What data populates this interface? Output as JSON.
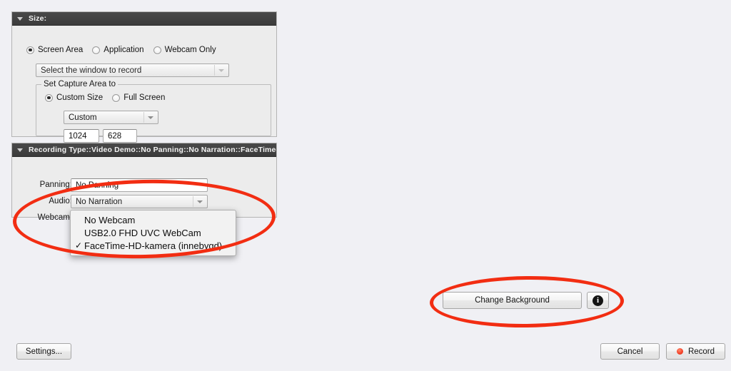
{
  "size_panel": {
    "title": "Size:",
    "disclosure_icon": "triangle-down-icon",
    "mode_options": [
      {
        "label": "Screen Area",
        "selected": true
      },
      {
        "label": "Application",
        "selected": false
      },
      {
        "label": "Webcam Only",
        "selected": false
      }
    ],
    "window_select": {
      "value": "Select the window to record",
      "enabled": false,
      "arrow_icon": "triangle-down-icon"
    },
    "capture_area": {
      "group_title": "Set Capture Area to",
      "options": [
        {
          "label": "Custom Size",
          "selected": true
        },
        {
          "label": "Full Screen",
          "selected": false
        }
      ],
      "preset_select": {
        "value": "Custom",
        "arrow_icon": "triangle-down-icon"
      },
      "width_field": {
        "value": "1024"
      },
      "height_field": {
        "value": "628"
      }
    }
  },
  "recording_panel": {
    "title": "Recording Type::Video Demo::No Panning::No Narration::FaceTime–...",
    "disclosure_icon": "triangle-down-icon",
    "fields": [
      {
        "label": "Panning:",
        "value": "No Panning",
        "type": "textinput"
      },
      {
        "label": "Audio:",
        "value": "No Narration",
        "type": "combo",
        "arrow_icon": "triangle-down-icon"
      },
      {
        "label": "Webcam:",
        "value": "FaceTime–HD–kamera (innebygd)",
        "type": "combo-focused",
        "arrow_icon": "triangle-down-icon"
      }
    ]
  },
  "webcam_menu": {
    "open": true,
    "check_glyph": "✓",
    "items": [
      {
        "label": "No Webcam",
        "checked": false
      },
      {
        "label": "USB2.0 FHD UVC WebCam",
        "checked": false
      },
      {
        "label": "FaceTime-HD-kamera (innebygd)",
        "checked": true
      }
    ]
  },
  "background_section": {
    "change_background_label": "Change Background",
    "info_glyph": "i",
    "info_icon": "info-circle-icon"
  },
  "footer": {
    "settings_label": "Settings...",
    "cancel_label": "Cancel",
    "record_label": "Record",
    "record_icon": "record-dot-icon"
  },
  "annotations": {
    "color": "#f22d12",
    "shapes": [
      {
        "name": "recording-type-highlight"
      },
      {
        "name": "change-background-highlight"
      }
    ]
  }
}
